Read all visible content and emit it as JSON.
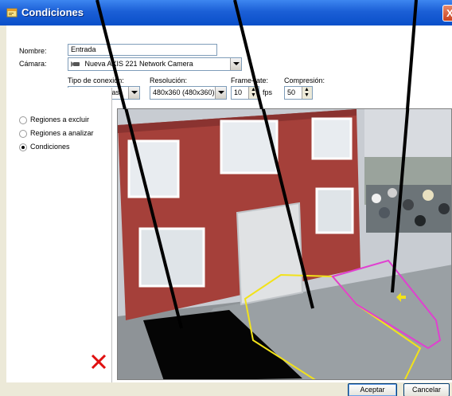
{
  "window": {
    "title": "Condiciones",
    "close_glyph": "X"
  },
  "form": {
    "nombre_label": "Nombre:",
    "nombre_value": "Entrada",
    "camara_label": "Cámara:",
    "camara_value": "Nueva AXIS 221 Network Camera",
    "tipo_label": "Tipo de conexión:",
    "tipo_value": "MJPEG Unicast",
    "resolucion_label": "Resolución:",
    "resolucion_value": "480x360 (480x360)",
    "framerate_label": "Frame-rate:",
    "framerate_value": "10",
    "framerate_unit": "fps",
    "compresion_label": "Compresión:",
    "compresion_value": "50"
  },
  "modes": {
    "items": [
      {
        "label": "Regiones a excluir",
        "checked": false
      },
      {
        "label": "Regiones a analizar",
        "checked": false
      },
      {
        "label": "Condiciones",
        "checked": true
      }
    ]
  },
  "footer": {
    "accept_label": "Aceptar",
    "cancel_label": "Cancelar"
  },
  "colors": {
    "region_yellow": "#f2e21a",
    "region_magenta": "#e040d0",
    "delete_red": "#e01010"
  },
  "icons": {
    "title": "form-window-icon",
    "camera": "camera-icon",
    "delete": "delete-x-icon",
    "arrow": "direction-arrow-icon"
  }
}
